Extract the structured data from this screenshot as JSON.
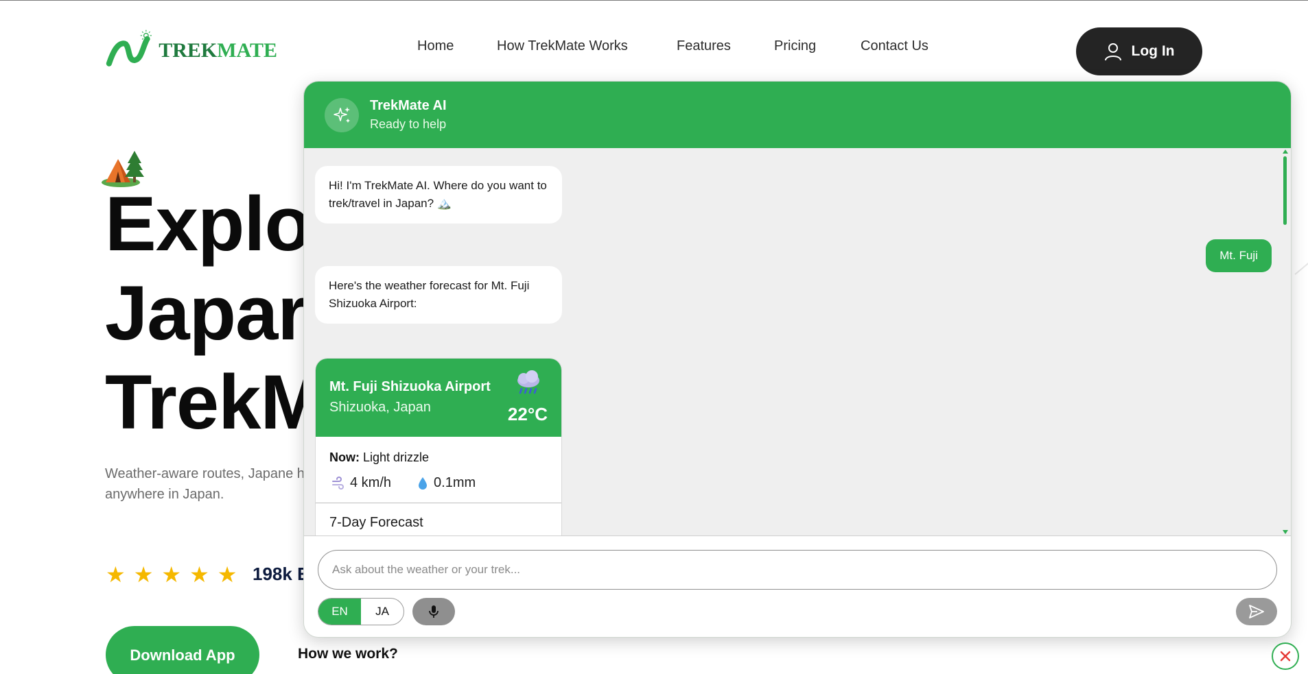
{
  "brand": {
    "logo_text_1": "TREK",
    "logo_text_2": "MATE"
  },
  "nav": {
    "items": [
      "Home",
      "How TrekMate Works",
      "Features",
      "Pricing",
      "Contact Us"
    ]
  },
  "header": {
    "login_label": "Log In"
  },
  "hero": {
    "title_line1": "Explo",
    "title_line2": "Japar",
    "title_line3": "TrekM",
    "description": "Weather-aware routes, Japane hikes from Mt. Fuji to Mt. Takac anywhere in Japan.",
    "rating_stars": 5,
    "rating_count": "198k E",
    "download_label": "Download App",
    "how_label": "How we work?"
  },
  "chat": {
    "bot_name": "TrekMate AI",
    "bot_status": "Ready to help",
    "messages": {
      "greeting": "Hi! I'm TrekMate AI. Where do you want to trek/travel in Japan? 🏔️",
      "user_reply": "Mt. Fuji",
      "forecast_intro": "Here's the weather forecast for Mt. Fuji Shizuoka Airport:"
    },
    "weather": {
      "location": "Mt. Fuji Shizuoka Airport",
      "region": "Shizuoka, Japan",
      "temperature": "22°C",
      "now_label": "Now:",
      "now_condition": "Light drizzle",
      "wind": "4 km/h",
      "precip": "0.1mm",
      "forecast_title": "7-Day Forecast",
      "icon": "rain-cloud-icon"
    },
    "input_placeholder": "Ask about the weather or your trek...",
    "languages": [
      "EN",
      "JA"
    ],
    "active_language": "EN"
  },
  "colors": {
    "accent": "#2fae52",
    "dark": "#242424",
    "star": "#f5b800"
  }
}
